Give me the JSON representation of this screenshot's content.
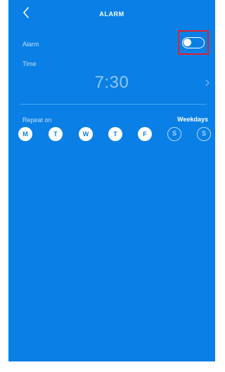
{
  "colors": {
    "background": "#0a80e6",
    "highlight": "#e0202f",
    "foreground": "#ffffff"
  },
  "header": {
    "back_icon": "chevron-left-icon",
    "title": "ALARM"
  },
  "alarm": {
    "label": "Alarm",
    "toggle_on": true
  },
  "time": {
    "label": "Time",
    "value": "7:30",
    "chevron_icon": "chevron-right-icon"
  },
  "repeat": {
    "label": "Repeat on",
    "value": "Weekdays",
    "days": [
      {
        "letter": "M",
        "selected": true
      },
      {
        "letter": "T",
        "selected": true
      },
      {
        "letter": "W",
        "selected": true
      },
      {
        "letter": "T",
        "selected": true
      },
      {
        "letter": "F",
        "selected": true
      },
      {
        "letter": "S",
        "selected": false
      },
      {
        "letter": "S",
        "selected": false
      }
    ]
  }
}
